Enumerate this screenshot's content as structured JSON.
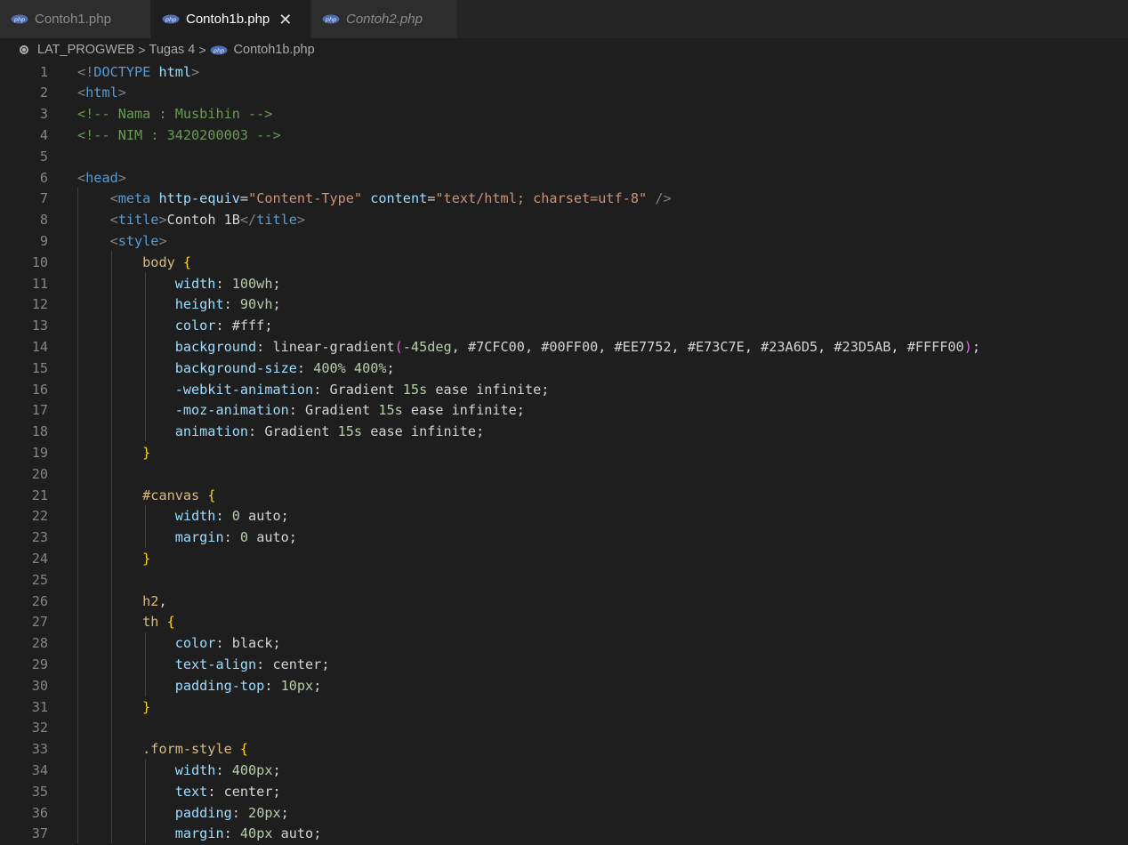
{
  "tabs": [
    {
      "label": "Contoh1.php",
      "icon": "php-file-icon",
      "state": "inactive"
    },
    {
      "label": "Contoh1b.php",
      "icon": "php-file-icon",
      "state": "active"
    },
    {
      "label": "Contoh2.php",
      "icon": "php-file-icon",
      "state": "preview"
    }
  ],
  "breadcrumb": {
    "root": "LAT_PROGWEB",
    "folder": "Tugas 4",
    "file": "Contoh1b.php",
    "separator": ">"
  },
  "editor": {
    "lines": [
      {
        "n": "1",
        "t": [
          [
            "t-brk",
            "<!"
          ],
          [
            "t-tag",
            "DOCTYPE"
          ],
          [
            "t-txt",
            " "
          ],
          [
            "t-attr",
            "html"
          ],
          [
            "t-brk",
            ">"
          ]
        ]
      },
      {
        "n": "2",
        "t": [
          [
            "t-brk",
            "<"
          ],
          [
            "t-tag",
            "html"
          ],
          [
            "t-brk",
            ">"
          ]
        ]
      },
      {
        "n": "3",
        "t": [
          [
            "t-cmt",
            "<!-- Nama : Musbihin -->"
          ]
        ]
      },
      {
        "n": "4",
        "t": [
          [
            "t-cmt",
            "<!-- NIM : 3420200003 -->"
          ]
        ]
      },
      {
        "n": "5",
        "t": []
      },
      {
        "n": "6",
        "t": [
          [
            "t-brk",
            "<"
          ],
          [
            "t-tag",
            "head"
          ],
          [
            "t-brk",
            ">"
          ]
        ]
      },
      {
        "n": "7",
        "t": [
          [
            "t-txt",
            "    "
          ],
          [
            "t-brk",
            "<"
          ],
          [
            "t-tag",
            "meta"
          ],
          [
            "t-txt",
            " "
          ],
          [
            "t-attr",
            "http-equiv"
          ],
          [
            "t-txt",
            "="
          ],
          [
            "t-str",
            "\"Content-Type\""
          ],
          [
            "t-txt",
            " "
          ],
          [
            "t-attr",
            "content"
          ],
          [
            "t-txt",
            "="
          ],
          [
            "t-str",
            "\"text/html; charset=utf-8\""
          ],
          [
            "t-txt",
            " "
          ],
          [
            "t-brk",
            "/>"
          ]
        ]
      },
      {
        "n": "8",
        "t": [
          [
            "t-txt",
            "    "
          ],
          [
            "t-brk",
            "<"
          ],
          [
            "t-tag",
            "title"
          ],
          [
            "t-brk",
            ">"
          ],
          [
            "t-txt",
            "Contoh 1B"
          ],
          [
            "t-brk",
            "</"
          ],
          [
            "t-tag",
            "title"
          ],
          [
            "t-brk",
            ">"
          ]
        ]
      },
      {
        "n": "9",
        "t": [
          [
            "t-txt",
            "    "
          ],
          [
            "t-brk",
            "<"
          ],
          [
            "t-tag",
            "style"
          ],
          [
            "t-brk",
            ">"
          ]
        ]
      },
      {
        "n": "10",
        "t": [
          [
            "t-txt",
            "        "
          ],
          [
            "t-sel",
            "body"
          ],
          [
            "t-txt",
            " "
          ],
          [
            "t-b1",
            "{"
          ]
        ]
      },
      {
        "n": "11",
        "t": [
          [
            "t-txt",
            "            "
          ],
          [
            "t-prop",
            "width"
          ],
          [
            "t-txt",
            ": "
          ],
          [
            "t-num",
            "100wh"
          ],
          [
            "t-txt",
            ";"
          ]
        ]
      },
      {
        "n": "12",
        "t": [
          [
            "t-txt",
            "            "
          ],
          [
            "t-prop",
            "height"
          ],
          [
            "t-txt",
            ": "
          ],
          [
            "t-num",
            "90vh"
          ],
          [
            "t-txt",
            ";"
          ]
        ]
      },
      {
        "n": "13",
        "t": [
          [
            "t-txt",
            "            "
          ],
          [
            "t-prop",
            "color"
          ],
          [
            "t-txt",
            ": #fff;"
          ]
        ]
      },
      {
        "n": "14",
        "t": [
          [
            "t-txt",
            "            "
          ],
          [
            "t-prop",
            "background"
          ],
          [
            "t-txt",
            ": linear-gradient"
          ],
          [
            "t-b2",
            "("
          ],
          [
            "t-num",
            "-45deg"
          ],
          [
            "t-txt",
            ", #7CFC00, #00FF00, #EE7752, #E73C7E, #23A6D5, #23D5AB, #FFFF00"
          ],
          [
            "t-b2",
            ")"
          ],
          [
            "t-txt",
            ";"
          ]
        ]
      },
      {
        "n": "15",
        "t": [
          [
            "t-txt",
            "            "
          ],
          [
            "t-prop",
            "background-size"
          ],
          [
            "t-txt",
            ": "
          ],
          [
            "t-num",
            "400%"
          ],
          [
            "t-txt",
            " "
          ],
          [
            "t-num",
            "400%"
          ],
          [
            "t-txt",
            ";"
          ]
        ]
      },
      {
        "n": "16",
        "t": [
          [
            "t-txt",
            "            "
          ],
          [
            "t-prop",
            "-webkit-animation"
          ],
          [
            "t-txt",
            ": Gradient "
          ],
          [
            "t-num",
            "15s"
          ],
          [
            "t-txt",
            " ease infinite;"
          ]
        ]
      },
      {
        "n": "17",
        "t": [
          [
            "t-txt",
            "            "
          ],
          [
            "t-prop",
            "-moz-animation"
          ],
          [
            "t-txt",
            ": Gradient "
          ],
          [
            "t-num",
            "15s"
          ],
          [
            "t-txt",
            " ease infinite;"
          ]
        ]
      },
      {
        "n": "18",
        "t": [
          [
            "t-txt",
            "            "
          ],
          [
            "t-prop",
            "animation"
          ],
          [
            "t-txt",
            ": Gradient "
          ],
          [
            "t-num",
            "15s"
          ],
          [
            "t-txt",
            " ease infinite;"
          ]
        ]
      },
      {
        "n": "19",
        "t": [
          [
            "t-txt",
            "        "
          ],
          [
            "t-b1",
            "}"
          ]
        ]
      },
      {
        "n": "20",
        "t": []
      },
      {
        "n": "21",
        "t": [
          [
            "t-txt",
            "        "
          ],
          [
            "t-sel",
            "#canvas"
          ],
          [
            "t-txt",
            " "
          ],
          [
            "t-b1",
            "{"
          ]
        ]
      },
      {
        "n": "22",
        "t": [
          [
            "t-txt",
            "            "
          ],
          [
            "t-prop",
            "width"
          ],
          [
            "t-txt",
            ": "
          ],
          [
            "t-num",
            "0"
          ],
          [
            "t-txt",
            " auto;"
          ]
        ]
      },
      {
        "n": "23",
        "t": [
          [
            "t-txt",
            "            "
          ],
          [
            "t-prop",
            "margin"
          ],
          [
            "t-txt",
            ": "
          ],
          [
            "t-num",
            "0"
          ],
          [
            "t-txt",
            " auto;"
          ]
        ]
      },
      {
        "n": "24",
        "t": [
          [
            "t-txt",
            "        "
          ],
          [
            "t-b1",
            "}"
          ]
        ]
      },
      {
        "n": "25",
        "t": []
      },
      {
        "n": "26",
        "t": [
          [
            "t-txt",
            "        "
          ],
          [
            "t-sel",
            "h2"
          ],
          [
            "t-txt",
            ","
          ]
        ]
      },
      {
        "n": "27",
        "t": [
          [
            "t-txt",
            "        "
          ],
          [
            "t-sel",
            "th"
          ],
          [
            "t-txt",
            " "
          ],
          [
            "t-b1",
            "{"
          ]
        ]
      },
      {
        "n": "28",
        "t": [
          [
            "t-txt",
            "            "
          ],
          [
            "t-prop",
            "color"
          ],
          [
            "t-txt",
            ": black;"
          ]
        ]
      },
      {
        "n": "29",
        "t": [
          [
            "t-txt",
            "            "
          ],
          [
            "t-prop",
            "text-align"
          ],
          [
            "t-txt",
            ": center;"
          ]
        ]
      },
      {
        "n": "30",
        "t": [
          [
            "t-txt",
            "            "
          ],
          [
            "t-prop",
            "padding-top"
          ],
          [
            "t-txt",
            ": "
          ],
          [
            "t-num",
            "10px"
          ],
          [
            "t-txt",
            ";"
          ]
        ]
      },
      {
        "n": "31",
        "t": [
          [
            "t-txt",
            "        "
          ],
          [
            "t-b1",
            "}"
          ]
        ]
      },
      {
        "n": "32",
        "t": []
      },
      {
        "n": "33",
        "t": [
          [
            "t-txt",
            "        "
          ],
          [
            "t-sel",
            ".form-style"
          ],
          [
            "t-txt",
            " "
          ],
          [
            "t-b1",
            "{"
          ]
        ]
      },
      {
        "n": "34",
        "t": [
          [
            "t-txt",
            "            "
          ],
          [
            "t-prop",
            "width"
          ],
          [
            "t-txt",
            ": "
          ],
          [
            "t-num",
            "400px"
          ],
          [
            "t-txt",
            ";"
          ]
        ]
      },
      {
        "n": "35",
        "t": [
          [
            "t-txt",
            "            "
          ],
          [
            "t-prop",
            "text"
          ],
          [
            "t-txt",
            ": center;"
          ]
        ]
      },
      {
        "n": "36",
        "t": [
          [
            "t-txt",
            "            "
          ],
          [
            "t-prop",
            "padding"
          ],
          [
            "t-txt",
            ": "
          ],
          [
            "t-num",
            "20px"
          ],
          [
            "t-txt",
            ";"
          ]
        ]
      },
      {
        "n": "37",
        "t": [
          [
            "t-txt",
            "            "
          ],
          [
            "t-prop",
            "margin"
          ],
          [
            "t-txt",
            ": "
          ],
          [
            "t-num",
            "40px"
          ],
          [
            "t-txt",
            " auto;"
          ]
        ]
      }
    ]
  }
}
